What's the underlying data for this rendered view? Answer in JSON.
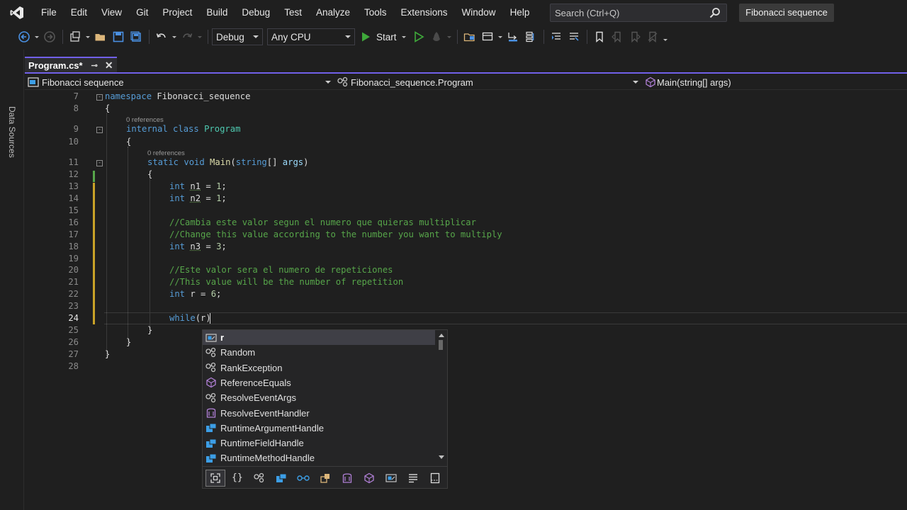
{
  "menubar": {
    "items": [
      "File",
      "Edit",
      "View",
      "Git",
      "Project",
      "Build",
      "Debug",
      "Test",
      "Analyze",
      "Tools",
      "Extensions",
      "Window",
      "Help"
    ],
    "search_placeholder": "Search (Ctrl+Q)",
    "solution_name": "Fibonacci sequence"
  },
  "toolbar": {
    "configuration": "Debug",
    "platform": "Any CPU",
    "start_label": "Start"
  },
  "side_tab": "Data Sources",
  "doc_tab": {
    "title": "Program.cs*",
    "pin": "⊸",
    "close": "✕"
  },
  "navbar": {
    "project": "Fibonacci sequence",
    "class": "Fibonacci_sequence.Program",
    "member": "Main(string[] args)"
  },
  "editor": {
    "current_line": 24,
    "line_numbers": [
      "7",
      "8",
      "9",
      "10",
      "11",
      "12",
      "13",
      "14",
      "15",
      "16",
      "17",
      "18",
      "19",
      "20",
      "21",
      "22",
      "23",
      "24",
      "25",
      "26",
      "27",
      "28"
    ],
    "codelens": [
      "0 references",
      "0 references"
    ],
    "code": {
      "l7_kw": "namespace",
      "l7_name": " Fibonacci_sequence",
      "l8": "{",
      "l9_kw": "internal class",
      "l9_ty": " Program",
      "l10": "{",
      "l11_kw": "static void",
      "l11_fn": " Main",
      "l11_p1": "(",
      "l11_kw2": "string",
      "l11_p2": "[] ",
      "l11_pm": "args",
      "l11_p3": ")",
      "l12": "{",
      "l13_kw": "int",
      "l13_sp": " ",
      "l13_var": "n1",
      "l13_rest": " = ",
      "l13_num": "1",
      "l13_end": ";",
      "l14_kw": "int",
      "l14_sp": " ",
      "l14_var": "n2",
      "l14_rest": " = ",
      "l14_num": "1",
      "l14_end": ";",
      "l16": "//Cambia este valor segun el numero que quieras multiplicar",
      "l17": "//Change this value according to the number you want to multiply",
      "l18_kw": "int",
      "l18_sp": " ",
      "l18_var": "n3",
      "l18_rest": " = ",
      "l18_num": "3",
      "l18_end": ";",
      "l20": "//Este valor sera el numero de repeticiones",
      "l21": "//This value will be the number of repetition",
      "l22_kw": "int",
      "l22_rest": " r = ",
      "l22_num": "6",
      "l22_end": ";",
      "l24_kw": "while",
      "l24_rest": "(r)",
      "l25": "}",
      "l26": "}",
      "l27": "}"
    }
  },
  "intellisense": {
    "items": [
      {
        "label": "r",
        "icon": "local-variable-icon"
      },
      {
        "label": "Random",
        "icon": "class-icon"
      },
      {
        "label": "RankException",
        "icon": "class-icon"
      },
      {
        "label": "ReferenceEquals",
        "icon": "method-icon"
      },
      {
        "label": "ResolveEventArgs",
        "icon": "class-icon"
      },
      {
        "label": "ResolveEventHandler",
        "icon": "delegate-icon"
      },
      {
        "label": "RuntimeArgumentHandle",
        "icon": "struct-icon"
      },
      {
        "label": "RuntimeFieldHandle",
        "icon": "struct-icon"
      },
      {
        "label": "RuntimeMethodHandle",
        "icon": "struct-icon"
      }
    ],
    "filters": [
      "expand-all-icon",
      "namespace-icon",
      "class-icon",
      "struct-icon",
      "interface-icon",
      "enum-icon",
      "delegate-icon",
      "method-icon",
      "local-icon",
      "keyword-icon",
      "snippet-icon"
    ],
    "colors": {
      "class": "#c5c5c5",
      "method": "#b180d7",
      "struct": "#3c9ee6",
      "selected_bg": "#3f3f46",
      "accent": "#7160e8"
    }
  }
}
